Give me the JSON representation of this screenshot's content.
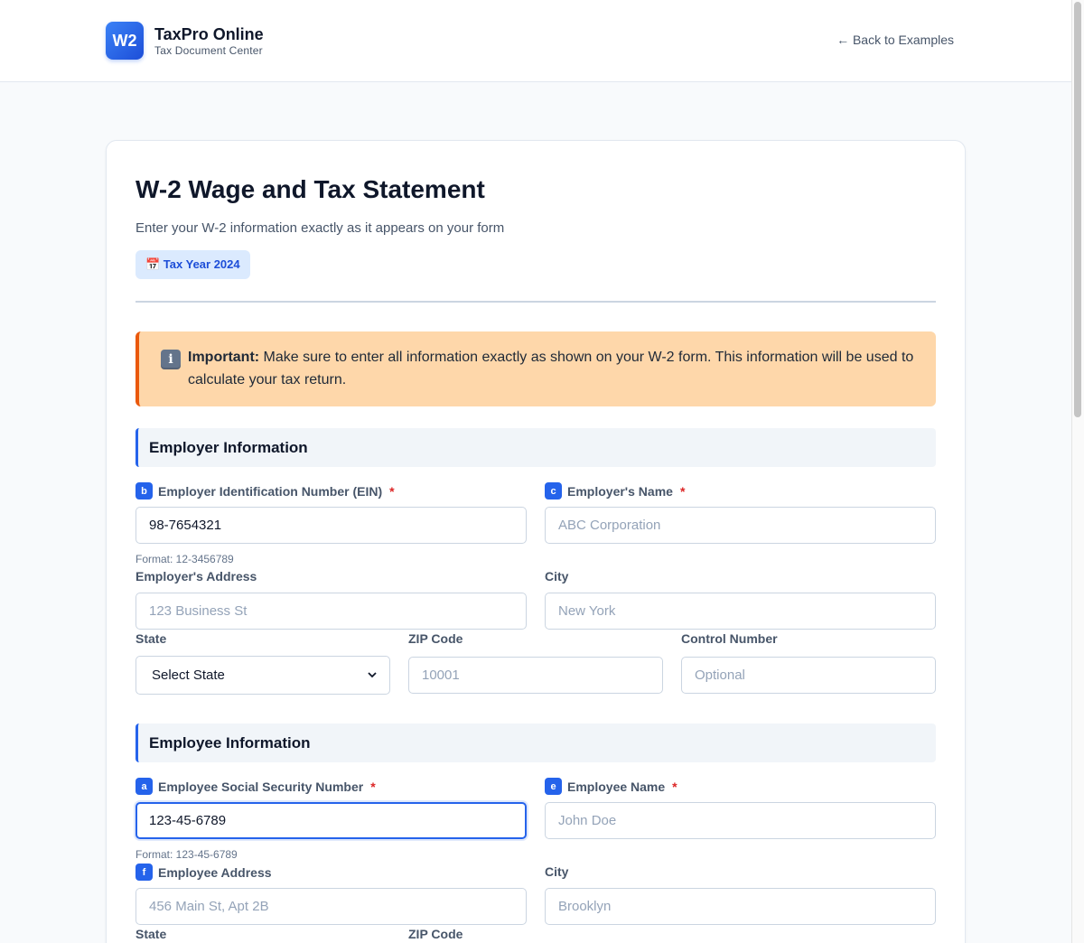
{
  "header": {
    "logo_text": "W2",
    "brand_name": "TaxPro Online",
    "brand_subtitle": "Tax Document Center",
    "back_link": "← Back to Examples"
  },
  "form": {
    "title": "W-2 Wage and Tax Statement",
    "subtitle": "Enter your W-2 information exactly as it appears on your form",
    "year_badge": "📅 Tax Year 2024",
    "alert": {
      "strong": "Important:",
      "text": " Make sure to enter all information exactly as shown on your W-2 form. This information will be used to calculate your tax return."
    }
  },
  "employer": {
    "section_title": "Employer Information",
    "ein": {
      "box": "b",
      "label": "Employer Identification Number (EIN)",
      "value": "98-7654321",
      "hint": "Format: 12-3456789"
    },
    "name": {
      "box": "c",
      "label": "Employer's Name",
      "placeholder": "ABC Corporation"
    },
    "address": {
      "label": "Employer's Address",
      "placeholder": "123 Business St"
    },
    "city": {
      "label": "City",
      "placeholder": "New York"
    },
    "state": {
      "label": "State",
      "value": "Select State"
    },
    "zip": {
      "label": "ZIP Code",
      "placeholder": "10001"
    },
    "control": {
      "label": "Control Number",
      "placeholder": "Optional"
    }
  },
  "employee": {
    "section_title": "Employee Information",
    "ssn": {
      "box": "a",
      "label": "Employee Social Security Number",
      "value": "123-45-6789",
      "hint": "Format: 123-45-6789"
    },
    "name": {
      "box": "e",
      "label": "Employee Name",
      "placeholder": "John Doe"
    },
    "address": {
      "box": "f",
      "label": "Employee Address",
      "placeholder": "456 Main St, Apt 2B"
    },
    "city": {
      "label": "City",
      "placeholder": "Brooklyn"
    },
    "state": {
      "label": "State"
    },
    "zip": {
      "label": "ZIP Code"
    }
  },
  "required_mark": "*",
  "icons": {
    "info": "information-icon",
    "calendar": "calendar-icon",
    "chevron": "chevron-down-icon"
  }
}
